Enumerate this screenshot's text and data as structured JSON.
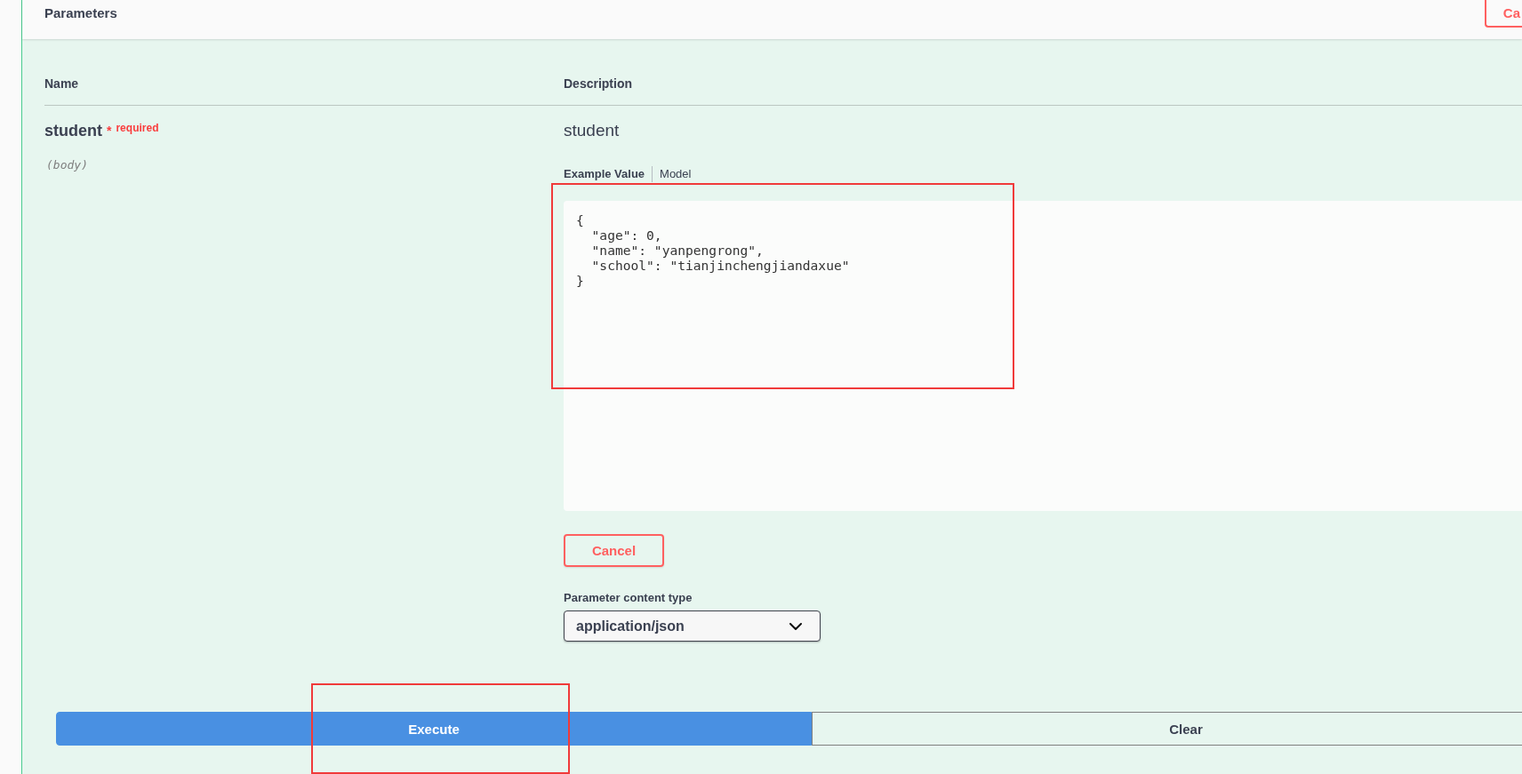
{
  "header": {
    "title": "Parameters",
    "cancel_button": "Ca"
  },
  "table": {
    "columns": [
      "Name",
      "Description"
    ]
  },
  "parameters": [
    {
      "name": "student",
      "required": true,
      "required_mark": "*",
      "required_label": "required",
      "location": "(body)",
      "description": "student",
      "example_tabs": [
        {
          "label": "Example Value",
          "selected": true
        },
        {
          "label": "Model",
          "selected": false
        }
      ],
      "example_value": "{\n  \"age\": 0,\n  \"name\": \"yanpengrong\",\n  \"school\": \"tianjinchengjiandaxue\"\n}",
      "cancel_button": "Cancel",
      "content_type_label": "Parameter content type",
      "content_type": "application/json"
    }
  ],
  "actions": [
    {
      "label": "Execute",
      "kind": "primary"
    },
    {
      "label": "Clear",
      "kind": "secondary"
    }
  ]
}
